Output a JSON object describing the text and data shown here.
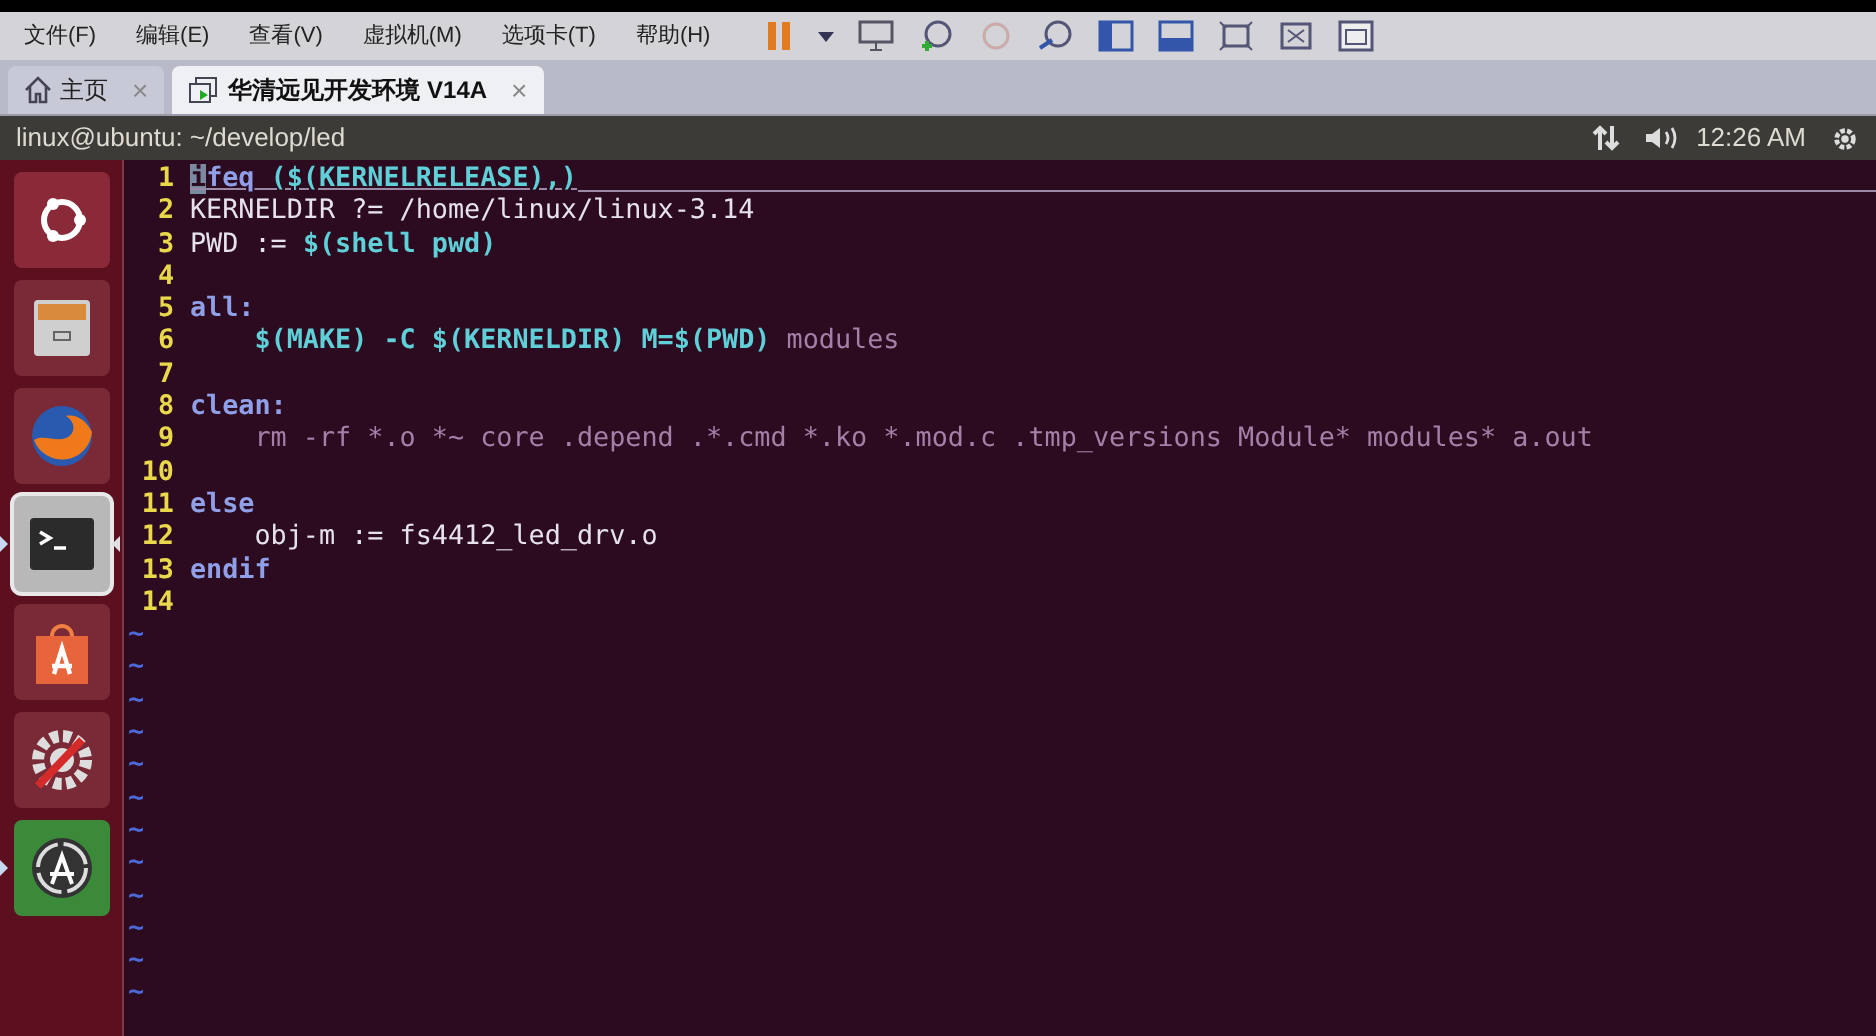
{
  "menu_bar": {
    "items": [
      "文件(F)",
      "编辑(E)",
      "查看(V)",
      "虚拟机(M)",
      "选项卡(T)",
      "帮助(H)"
    ]
  },
  "tabs": [
    {
      "label": "主页",
      "kind": "home",
      "selected": false,
      "close": "×"
    },
    {
      "label": "华清远见开发环境 V14A",
      "kind": "vm",
      "selected": true,
      "close": "×"
    }
  ],
  "top_panel": {
    "title": "linux@ubuntu: ~/develop/led",
    "clock": "12:26 AM"
  },
  "launcher": [
    {
      "kind": "dash",
      "running": false,
      "selected": false
    },
    {
      "kind": "files",
      "running": false,
      "selected": false
    },
    {
      "kind": "browser",
      "running": false,
      "selected": false
    },
    {
      "kind": "terminal",
      "running": true,
      "selected": true
    },
    {
      "kind": "store",
      "running": false,
      "selected": false
    },
    {
      "kind": "settings",
      "running": false,
      "selected": false
    },
    {
      "kind": "updater",
      "running": true,
      "selected": false
    }
  ],
  "editor": {
    "lines": [
      {
        "number": "1",
        "cursor_line": true,
        "segments": [
          {
            "text": "ifeq",
            "kind": "keyword"
          },
          {
            "text": " ($(KERNELRELEASE),)",
            "kind": "variable"
          }
        ]
      },
      {
        "number": "2",
        "cursor_line": false,
        "segments": [
          {
            "text": "KERNELDIR ?= /home/linux/linux-3.14",
            "kind": "plain"
          }
        ]
      },
      {
        "number": "3",
        "cursor_line": false,
        "segments": [
          {
            "text": "PWD := ",
            "kind": "plain"
          },
          {
            "text": "$(shell pwd)",
            "kind": "variable"
          }
        ]
      },
      {
        "number": "4",
        "cursor_line": false
      },
      {
        "number": "5",
        "cursor_line": false,
        "segments": [
          {
            "text": "all:",
            "kind": "keyword"
          }
        ]
      },
      {
        "number": "6",
        "cursor_line": false,
        "segments": [
          {
            "text": "    $(MAKE) -C $(KERNELDIR) M=$(PWD)",
            "kind": "variable"
          },
          {
            "text": " modules",
            "kind": "command"
          }
        ]
      },
      {
        "number": "7",
        "cursor_line": false
      },
      {
        "number": "8",
        "cursor_line": false,
        "segments": [
          {
            "text": "clean:",
            "kind": "keyword"
          }
        ]
      },
      {
        "number": "9",
        "cursor_line": false,
        "segments": [
          {
            "text": "    rm -rf *.o *~ core .depend .*.cmd *.ko *.mod.c .tmp_versions Module* modules* a.out",
            "kind": "command"
          }
        ]
      },
      {
        "number": "10",
        "cursor_line": false
      },
      {
        "number": "11",
        "cursor_line": false,
        "segments": [
          {
            "text": "else",
            "kind": "keyword"
          }
        ]
      },
      {
        "number": "12",
        "cursor_line": false,
        "segments": [
          {
            "text": "    obj-m := fs4412_led_drv.o",
            "kind": "plain"
          }
        ]
      },
      {
        "number": "13",
        "cursor_line": false,
        "segments": [
          {
            "text": "endif",
            "kind": "keyword"
          }
        ]
      },
      {
        "number": "14",
        "cursor_line": false
      }
    ],
    "filler_lines": [
      "~",
      "~",
      "~",
      "~",
      "~",
      "~",
      "~",
      "~",
      "~",
      "~",
      "~",
      "~"
    ]
  }
}
